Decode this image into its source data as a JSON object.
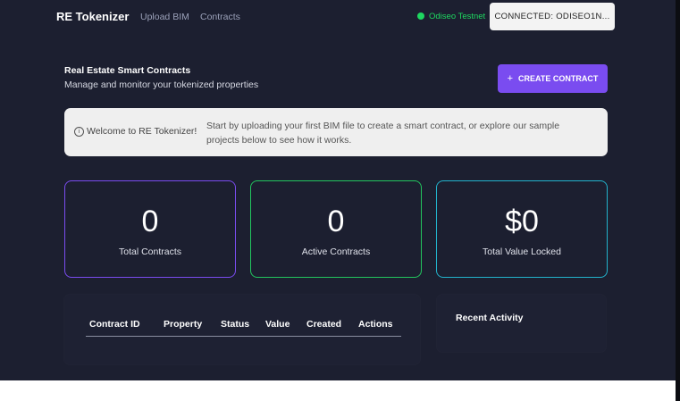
{
  "nav": {
    "brand": "RE Tokenizer",
    "links": [
      "Upload BIM",
      "Contracts"
    ],
    "network": "Odiseo Testnet",
    "connect_label": "CONNECTED: ODISEO1N..."
  },
  "header": {
    "title": "Real Estate Smart Contracts",
    "subtitle": "Manage and monitor your tokenized properties",
    "create_label": "CREATE CONTRACT",
    "create_icon": "plus-icon"
  },
  "banner": {
    "icon": "info-icon",
    "heading": "Welcome to RE Tokenizer!",
    "text": "Start by uploading your first BIM file to create a smart contract, or explore our sample projects below to see how it works."
  },
  "stats": [
    {
      "value": "0",
      "label": "Total Contracts"
    },
    {
      "value": "0",
      "label": "Active Contracts"
    },
    {
      "value": "$0",
      "label": "Total Value Locked"
    }
  ],
  "table": {
    "columns": [
      "Contract ID",
      "Property",
      "Status",
      "Value",
      "Created",
      "Actions"
    ]
  },
  "activity": {
    "title": "Recent Activity"
  },
  "colors": {
    "background": "#1c1f30",
    "accent_purple": "#7a4cf0",
    "green": "#22c55e",
    "teal": "#22b3cc",
    "network_green": "#1ed760"
  }
}
